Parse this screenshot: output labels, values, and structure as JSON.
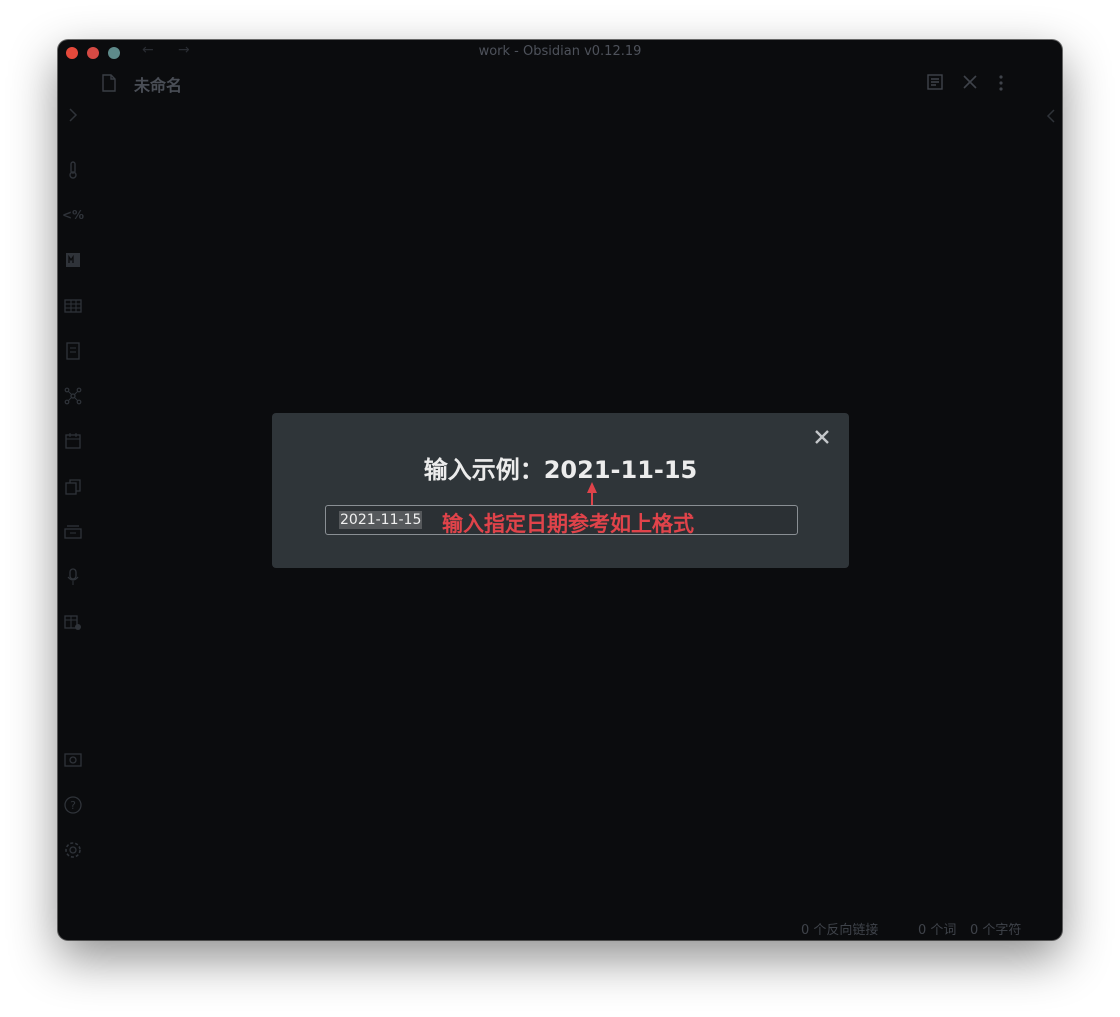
{
  "window": {
    "title": "work - Obsidian v0.12.19",
    "traffic_colors": {
      "close": "#e5493b",
      "minimize": "#d54a44",
      "zoom": "#5e8a8a"
    }
  },
  "tab": {
    "file_title": "未命名",
    "actions": [
      "preview-icon",
      "close-icon",
      "more-icon"
    ]
  },
  "ribbon_icons": [
    "thermometer-icon",
    "templater-icon",
    "markdown-icon",
    "table-icon",
    "document-icon",
    "graph-icon",
    "calendar-icon",
    "copy-icon",
    "archive-icon",
    "microphone-icon",
    "table-settings-icon",
    "vault-icon",
    "help-icon",
    "settings-icon"
  ],
  "modal": {
    "title": "输入示例：2021-11-15",
    "input_value": "2021-11-15",
    "annotation": "输入指定日期参考如上格式",
    "annotation_color": "#e0434a"
  },
  "status_bar": {
    "backlinks": "0 个反向链接",
    "words": "0 个词",
    "chars": "0 个字符"
  }
}
